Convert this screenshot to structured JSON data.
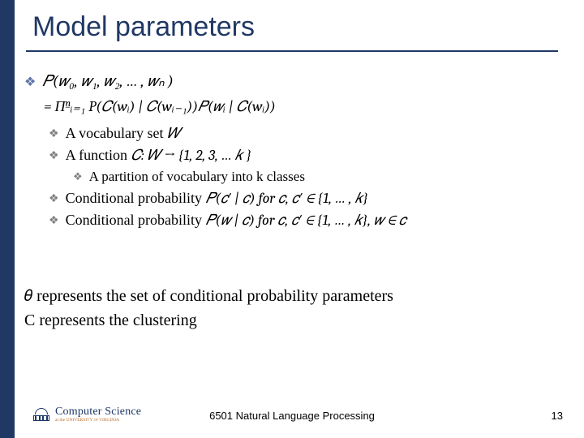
{
  "title": "Model parameters",
  "lines": {
    "joint": "𝑃(𝑤₀, 𝑤₁, 𝑤₂, … , 𝑤ₙ )",
    "product": "= Πⁿᵢ₌₁ P(𝐶(wᵢ) | 𝐶(wᵢ₋₁))𝑃(𝑤ᵢ | 𝐶(wᵢ))",
    "vocab_pre": "A vocabulary set ",
    "vocab_sym": "𝑊",
    "func_pre": "A function ",
    "func_body": "𝐶: 𝑊 → {1, 2, 3, … 𝑘 }",
    "partition": "A partition of vocabulary into k classes",
    "cond1_pre": "Conditional probability ",
    "cond1_mid": "𝑃(𝑐′ | 𝑐)",
    "cond1_post": " for 𝑐, 𝑐′ ∈ {1, … , 𝑘}",
    "cond2_pre": "Conditional probability ",
    "cond2_mid": "𝑃(𝑤 | 𝑐)",
    "cond2_post": " for 𝑐, 𝑐′ ∈ {1, … , 𝑘}, 𝑤 ∈ 𝑐"
  },
  "summary": {
    "line1": "𝜃 represents the  set of conditional probability parameters",
    "line2": "C represents the clustering"
  },
  "footer": {
    "course": "6501 Natural Language Processing",
    "page": "13",
    "logo_main": "Computer Science",
    "logo_sub_pre": "at the ",
    "logo_sub_uva": "UNIVERSITY of VIRGINIA"
  }
}
